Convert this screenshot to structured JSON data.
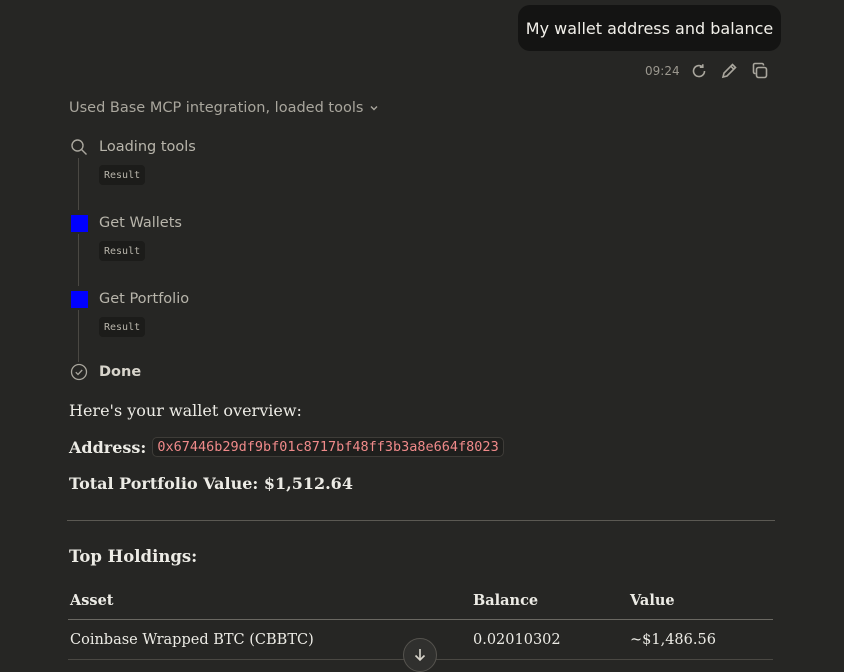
{
  "user_message": {
    "text": "My wallet address and balance",
    "time": "09:24"
  },
  "tool_use": {
    "summary": "Used Base MCP integration, loaded tools",
    "steps": [
      {
        "label": "Loading tools",
        "result": "Result"
      },
      {
        "label": "Get Wallets",
        "result": "Result"
      },
      {
        "label": "Get Portfolio",
        "result": "Result"
      }
    ],
    "done_label": "Done"
  },
  "response": {
    "intro": "Here's your wallet overview:",
    "address_label": "Address:",
    "address_value": "0x67446b29df9bf01c8717bf48ff3b3a8e664f8023",
    "total_label": "Total Portfolio Value: $1,512.64",
    "holdings_title": "Top Holdings:",
    "table": {
      "headers": [
        "Asset",
        "Balance",
        "Value"
      ],
      "rows": [
        [
          "Coinbase Wrapped BTC (CBBTC)",
          "0.02010302",
          "~$1,486.56"
        ]
      ]
    }
  },
  "colors": {
    "background": "#262624",
    "bubble": "#141413",
    "code_text": "#f08a8a",
    "step_marker": "#0000ff"
  }
}
